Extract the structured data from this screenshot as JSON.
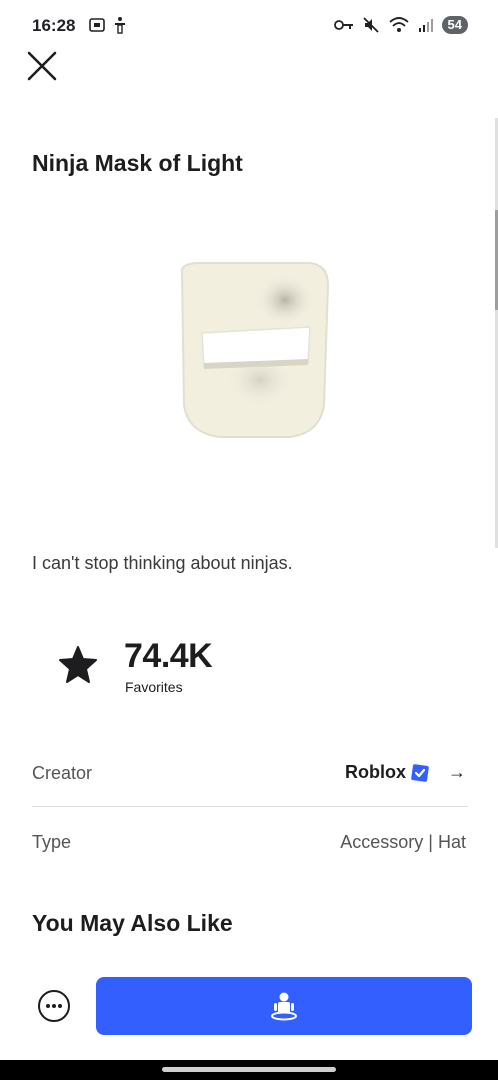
{
  "status_bar": {
    "time": "16:28",
    "battery": "54",
    "icons_left": [
      "screenshot-icon",
      "accessibility-icon"
    ],
    "icons_right": [
      "key-icon",
      "mute-icon",
      "wifi-icon",
      "signal-icon"
    ]
  },
  "item": {
    "title": "Ninja Mask of Light",
    "description": "I can't stop thinking about ninjas.",
    "favorites_count": "74.4K",
    "favorites_label": "Favorites"
  },
  "details": {
    "creator_label": "Creator",
    "creator_value": "Roblox",
    "creator_verified": true,
    "creator_arrow": "→",
    "type_label": "Type",
    "type_value": "Accessory | Hat"
  },
  "recommendations": {
    "title": "You May Also Like"
  },
  "actions": {
    "more_icon": "more-icon",
    "try_on_icon": "avatar-try-on-icon"
  },
  "colors": {
    "primary_button": "#335fff",
    "verified_badge": "#335fff",
    "text": "#1d1d1f"
  }
}
